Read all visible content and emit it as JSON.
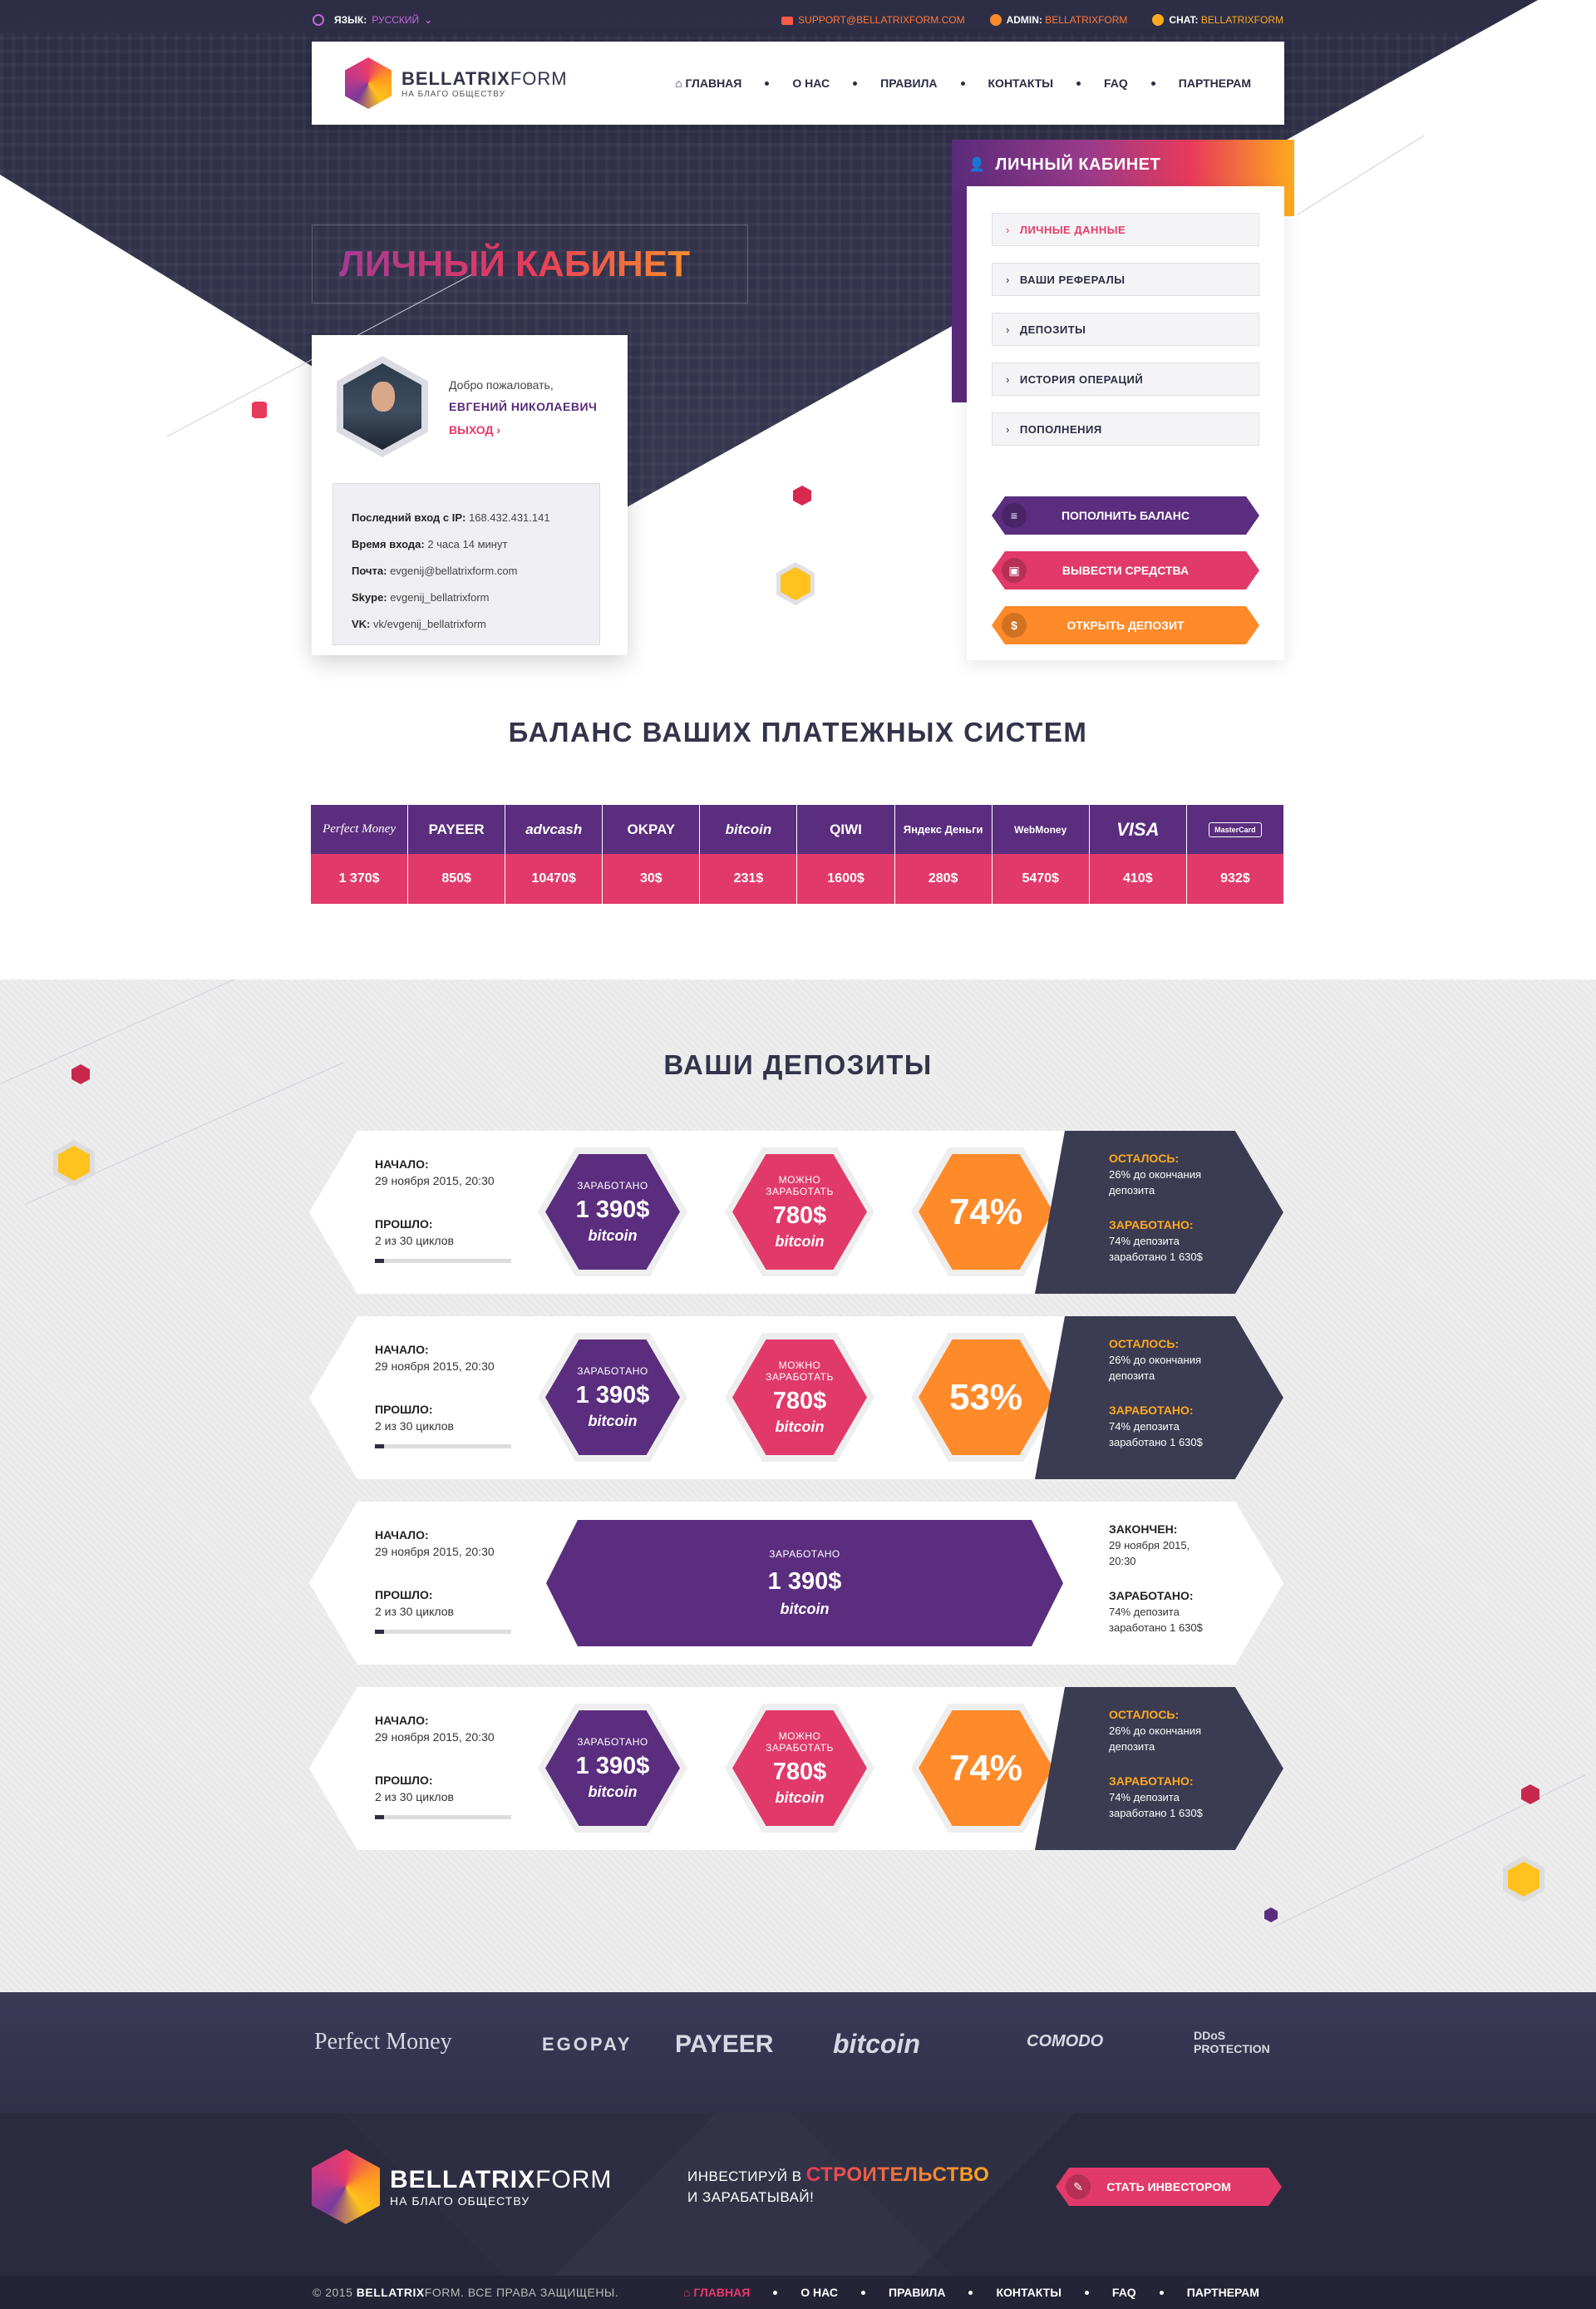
{
  "topbar": {
    "lang_label": "ЯЗЫК:",
    "lang_value": "РУССКИЙ",
    "support_email": "SUPPORT@BELLATRIXFORM.COM",
    "admin_label": "ADMIN:",
    "admin_value": "BELLATRIXFORM",
    "chat_label": "CHAT:",
    "chat_value": "BELLATRIXFORM"
  },
  "brand": {
    "name_bold": "BELLATRIX",
    "name_light": "FORM",
    "tagline": "НА БЛАГО ОБЩЕСТВУ"
  },
  "nav": [
    "ГЛАВНАЯ",
    "О НАС",
    "ПРАВИЛА",
    "КОНТАКТЫ",
    "FAQ",
    "ПАРТНЕРАМ"
  ],
  "hero": {
    "title": "ЛИЧНЫЙ КАБИНЕТ"
  },
  "profile": {
    "welcome": "Добро пожаловать,",
    "name": "ЕВГЕНИЙ НИКОЛАЕВИЧ",
    "logout": "ВЫХОД",
    "info": [
      {
        "label": "Последний вход с IP:",
        "value": "168.432.431.141"
      },
      {
        "label": "Время входа:",
        "value": "2 часа 14 минут"
      },
      {
        "label": "Почта:",
        "value": "evgenij@bellatrixform.com"
      },
      {
        "label": "Skype:",
        "value": "evgenij_bellatrixform"
      },
      {
        "label": "VK:",
        "value": "vk/evgenij_bellatrixform"
      }
    ]
  },
  "cabinet": {
    "title": "ЛИЧНЫЙ КАБИНЕТ",
    "menu": [
      "ЛИЧНЫЕ ДАННЫЕ",
      "ВАШИ РЕФЕРАЛЫ",
      "ДЕПОЗИТЫ",
      "ИСТОРИЯ ОПЕРАЦИЙ",
      "ПОПОЛНЕНИЯ"
    ],
    "actions": [
      {
        "label": "ПОПОЛНИТЬ БАЛАНС",
        "color": "#5b2d7e"
      },
      {
        "label": "ВЫВЕСТИ СРЕДСТВА",
        "color": "#e13a6a"
      },
      {
        "label": "ОТКРЫТЬ ДЕПОЗИТ",
        "color": "#ff8a2a"
      }
    ]
  },
  "balances": {
    "title": "БАЛАНС ВАШИХ ПЛАТЕЖНЫХ СИСТЕМ",
    "systems": [
      {
        "name": "Perfect Money",
        "value": "1 370$"
      },
      {
        "name": "PAYEER",
        "value": "850$"
      },
      {
        "name": "advcash",
        "value": "10470$"
      },
      {
        "name": "OKPAY",
        "value": "30$"
      },
      {
        "name": "bitcoin",
        "value": "231$"
      },
      {
        "name": "QIWI",
        "value": "1600$"
      },
      {
        "name": "Яндекс Деньги",
        "value": "280$"
      },
      {
        "name": "WebMoney",
        "value": "5470$"
      },
      {
        "name": "VISA",
        "value": "410$"
      },
      {
        "name": "MasterCard",
        "value": "932$"
      }
    ]
  },
  "deposits": {
    "title": "ВАШИ ДЕПОЗИТЫ",
    "items": [
      {
        "start_label": "НАЧАЛО:",
        "start": "29 ноября 2015, 20:30",
        "passed_label": "ПРОШЛО:",
        "passed": "2 из 30 циклов",
        "progress": 0.07,
        "earned_label": "ЗАРАБОТАНО",
        "earned": "1 390$",
        "can_label": "МОЖНО ЗАРАБОТАТЬ",
        "can": "780$",
        "currency": "bitcoin",
        "percent": "74%",
        "left_label": "ОСТАЛОСЬ:",
        "left_text": "26% до окончания депозита",
        "earned2_label": "ЗАРАБОТАНО:",
        "earned2_text": "74% депозита заработано 1 630$"
      },
      {
        "start_label": "НАЧАЛО:",
        "start": "29 ноября 2015, 20:30",
        "passed_label": "ПРОШЛО:",
        "passed": "2 из 30 циклов",
        "progress": 0.07,
        "earned_label": "ЗАРАБОТАНО",
        "earned": "1 390$",
        "can_label": "МОЖНО ЗАРАБОТАТЬ",
        "can": "780$",
        "currency": "bitcoin",
        "percent": "53%",
        "left_label": "ОСТАЛОСЬ:",
        "left_text": "26% до окончания депозита",
        "earned2_label": "ЗАРАБОТАНО:",
        "earned2_text": "74% депозита заработано 1 630$"
      },
      {
        "start_label": "НАЧАЛО:",
        "start": "29 ноября 2015, 20:30",
        "passed_label": "ПРОШЛО:",
        "passed": "2 из 30 циклов",
        "progress": 0.07,
        "earned_label": "ЗАРАБОТАНО",
        "earned": "1 390$",
        "currency": "bitcoin",
        "finished_label": "ЗАКОНЧЕН:",
        "finished": "29 ноября 2015, 20:30",
        "earned2_label": "ЗАРАБОТАНО:",
        "earned2_text": "74% депозита заработано 1 630$"
      },
      {
        "start_label": "НАЧАЛО:",
        "start": "29 ноября 2015, 20:30",
        "passed_label": "ПРОШЛО:",
        "passed": "2 из 30 циклов",
        "progress": 0.07,
        "earned_label": "ЗАРАБОТАНО",
        "earned": "1 390$",
        "can_label": "МОЖНО ЗАРАБОТАТЬ",
        "can": "780$",
        "currency": "bitcoin",
        "percent": "74%",
        "left_label": "ОСТАЛОСЬ:",
        "left_text": "26% до окончания депозита",
        "earned2_label": "ЗАРАБОТАНО:",
        "earned2_text": "74% депозита заработано 1 630$"
      }
    ]
  },
  "partners": [
    "Perfect Money",
    "EGOPAY",
    "PAYEER",
    "bitcoin",
    "COMODO",
    "DDoS PROTECTION"
  ],
  "footer": {
    "invest_line1": "ИНВЕСТИРУЙ В",
    "invest_highlight": "СТРОИТЕЛЬСТВО",
    "invest_line2": "И ЗАРАБАТЫВАЙ!",
    "invest_button": "СТАТЬ ИНВЕСТОРОМ",
    "copyright_prefix": "© 2015",
    "copyright_brand_bold": "BELLATRIX",
    "copyright_rest": "FORM. ВСЕ ПРАВА ЗАЩИЩЕНЫ.",
    "nav": [
      "ГЛАВНАЯ",
      "О НАС",
      "ПРАВИЛА",
      "КОНТАКТЫ",
      "FAQ",
      "ПАРТНЕРАМ"
    ]
  },
  "colors": {
    "purple": "#5b2d7e",
    "pink": "#e13a6a",
    "orange": "#ff8a2a",
    "yellow": "#ffc21e",
    "dark": "#2c2c44"
  }
}
